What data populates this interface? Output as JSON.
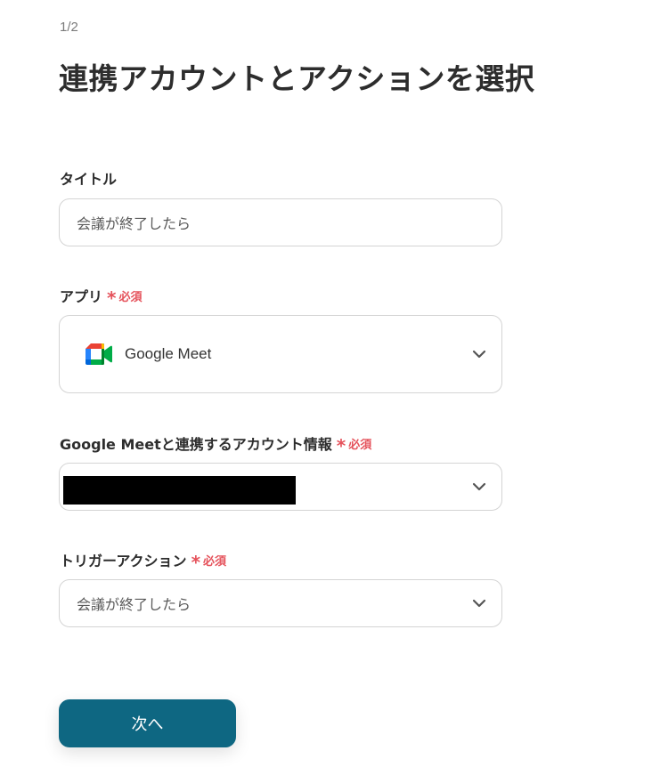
{
  "header": {
    "step": "1/2",
    "title": "連携アカウントとアクションを選択"
  },
  "required_text": "必須",
  "colors": {
    "accent": "#0e6782",
    "required": "#e5525b",
    "border": "#d4d4d4"
  },
  "fields": {
    "title": {
      "label": "タイトル",
      "value": "会議が終了したら"
    },
    "app": {
      "label": "アプリ",
      "value": "Google Meet",
      "icon": "google-meet-icon"
    },
    "account": {
      "label": "Google Meetと連携するアカウント情報",
      "value": ""
    },
    "trigger": {
      "label": "トリガーアクション",
      "value": "会議が終了したら"
    }
  },
  "buttons": {
    "next": "次へ"
  }
}
